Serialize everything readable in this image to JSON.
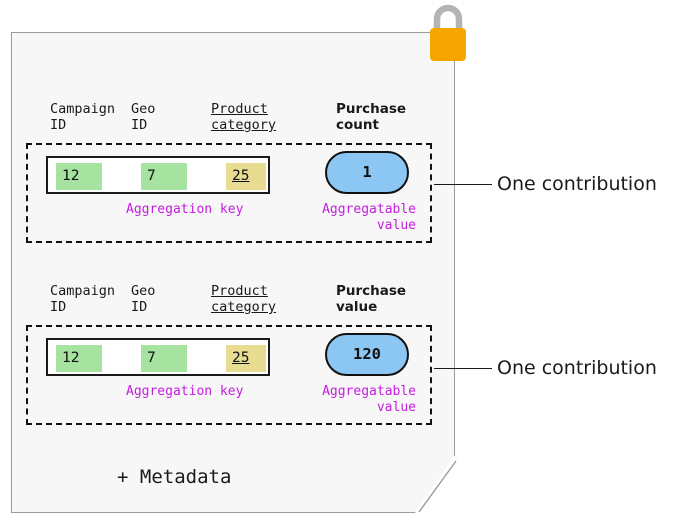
{
  "card": {
    "metadata_label": "+ Metadata"
  },
  "lock": {
    "icon": "padlock-icon",
    "body_color": "#f7a501",
    "shackle_color": "#b4b4b4"
  },
  "colors": {
    "key_green": "#a6e3a1",
    "key_yellow": "#e8dc93",
    "value_blue": "#8cc6f2",
    "note_purple": "#c61ee0",
    "card_bg": "#f7f7f7",
    "card_border": "#9a9a9a",
    "ink": "#111111"
  },
  "contributions": [
    {
      "headers": {
        "campaign_line1": "Campaign",
        "campaign_line2": "ID",
        "geo_line1": "Geo",
        "geo_line2": "ID",
        "product_line1": "Product",
        "product_line2": "category",
        "metric_line1": "Purchase",
        "metric_line2": "count"
      },
      "key": {
        "campaign_id": "12",
        "geo_id": "7",
        "product_category": "25"
      },
      "value": "1",
      "notes": {
        "aggregation_key": "Aggregation key",
        "aggregatable_value_line1": "Aggregatable",
        "aggregatable_value_line2": "value"
      },
      "annotation": "One contribution"
    },
    {
      "headers": {
        "campaign_line1": "Campaign",
        "campaign_line2": "ID",
        "geo_line1": "Geo",
        "geo_line2": "ID",
        "product_line1": "Product",
        "product_line2": "category",
        "metric_line1": "Purchase",
        "metric_line2": "value"
      },
      "key": {
        "campaign_id": "12",
        "geo_id": "7",
        "product_category": "25"
      },
      "value": "120",
      "notes": {
        "aggregation_key": "Aggregation key",
        "aggregatable_value_line1": "Aggregatable",
        "aggregatable_value_line2": "value"
      },
      "annotation": "One contribution"
    }
  ]
}
